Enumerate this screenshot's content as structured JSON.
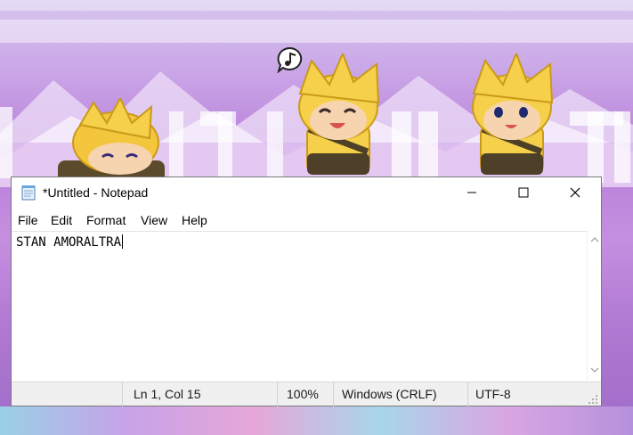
{
  "window": {
    "title": "*Untitled - Notepad",
    "app_icon": "notepad-icon",
    "controls": [
      "minimize-icon",
      "maximize-icon",
      "close-icon"
    ]
  },
  "menu": {
    "items": [
      "File",
      "Edit",
      "Format",
      "View",
      "Help"
    ]
  },
  "editor": {
    "content": "STAN AMORALTRA"
  },
  "status": {
    "position": "Ln 1, Col 15",
    "zoom": "100%",
    "line_ending": "Windows (CRLF)",
    "encoding": "UTF-8"
  },
  "colors": {
    "wallpaper_accent": "#b77fd9",
    "window_bg": "#ffffff",
    "statusbar_bg": "#f0f0f0"
  }
}
